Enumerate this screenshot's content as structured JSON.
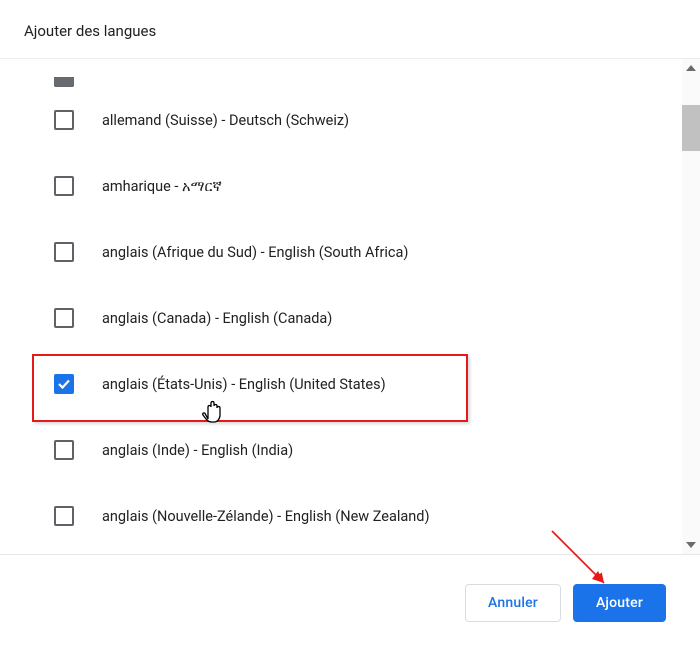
{
  "dialog": {
    "title": "Ajouter des langues"
  },
  "languages": [
    {
      "label": "allemand (Suisse) - Deutsch (Schweiz)",
      "checked": false,
      "slug": "allemand-suisse"
    },
    {
      "label": "amharique - አማርኛ",
      "checked": false,
      "slug": "amharique"
    },
    {
      "label": "anglais (Afrique du Sud) - English (South Africa)",
      "checked": false,
      "slug": "anglais-afrique-du-sud"
    },
    {
      "label": "anglais (Canada) - English (Canada)",
      "checked": false,
      "slug": "anglais-canada"
    },
    {
      "label": "anglais (États-Unis) - English (United States)",
      "checked": true,
      "slug": "anglais-etats-unis"
    },
    {
      "label": "anglais (Inde) - English (India)",
      "checked": false,
      "slug": "anglais-inde"
    },
    {
      "label": "anglais (Nouvelle-Zélande) - English (New Zealand)",
      "checked": false,
      "slug": "anglais-nouvelle-zelande"
    }
  ],
  "buttons": {
    "cancel": "Annuler",
    "add": "Ajouter"
  }
}
